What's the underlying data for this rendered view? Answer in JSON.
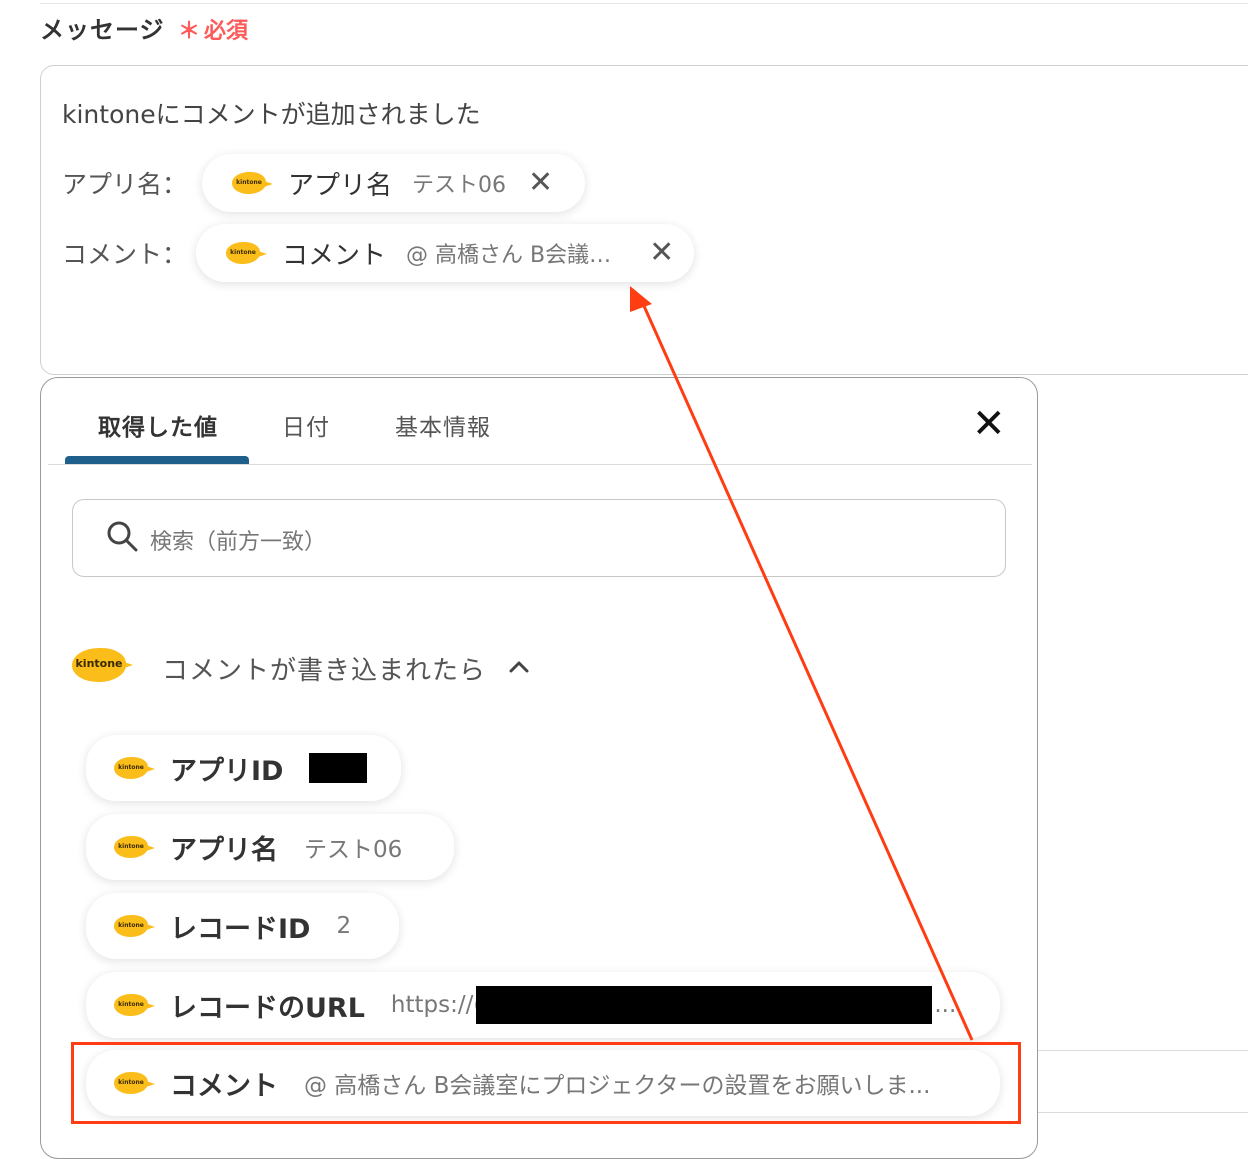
{
  "field": {
    "label": "メッセージ",
    "required_mark": "＊",
    "required_text": "必須"
  },
  "message": {
    "line1": "kintoneにコメントが追加されました",
    "app_label": "アプリ名：",
    "comment_label": "コメント："
  },
  "chips": {
    "app": {
      "logo": "kintone",
      "name": "アプリ名",
      "value": "テスト06",
      "remove": "✕"
    },
    "comment": {
      "logo": "kintone",
      "name": "コメント",
      "value": "@ 高橋さん B会議…",
      "remove": "✕"
    }
  },
  "panel": {
    "tabs": [
      {
        "label": "取得した値"
      },
      {
        "label": "日付"
      },
      {
        "label": "基本情報"
      }
    ],
    "close": "✕",
    "search_placeholder": "検索（前方一致）",
    "group": {
      "logo": "kintone",
      "title": "コメントが書き込まれたら"
    },
    "rows": [
      {
        "logo": "kintone",
        "name": "アプリID",
        "value": ""
      },
      {
        "logo": "kintone",
        "name": "アプリ名",
        "value": "テスト06"
      },
      {
        "logo": "kintone",
        "name": "レコードID",
        "value": "2"
      },
      {
        "logo": "kintone",
        "name": "レコードのURL",
        "value": "https://(",
        "value_end": "..."
      },
      {
        "logo": "kintone",
        "name": "コメント",
        "value": "@ 高橋さん B会議室にプロジェクターの設置をお願いしま..."
      }
    ]
  },
  "colors": {
    "required": "#ff5a5a",
    "tab_accent": "#1f5f8b",
    "annotation": "#ff3d12",
    "kintone_logo": "#fbbd1a"
  }
}
